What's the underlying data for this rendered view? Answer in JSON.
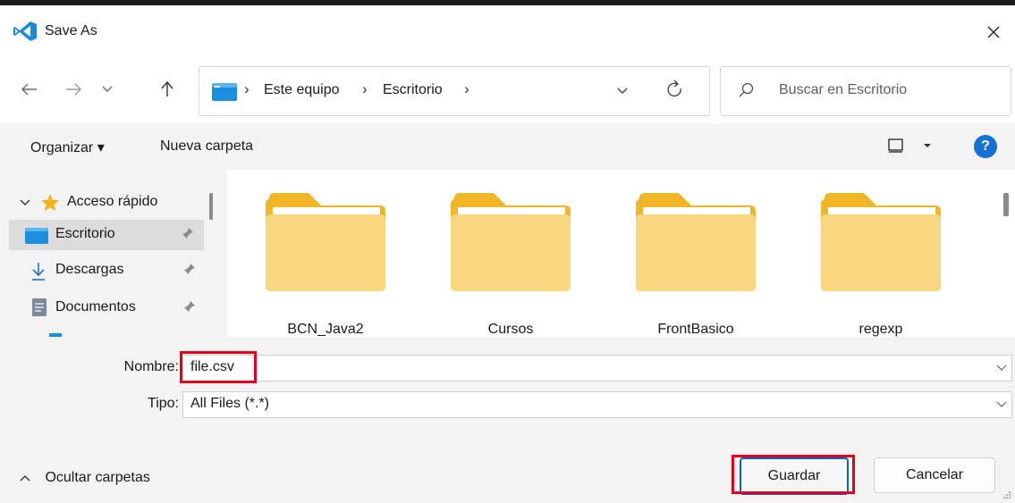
{
  "window": {
    "title": "Save As",
    "app_icon": "vscode-icon",
    "close_glyph": "✕"
  },
  "navigation": {
    "back_glyph": "←",
    "forward_glyph": "→",
    "recent_glyph": "⌄",
    "up_glyph": "↑",
    "breadcrumb": [
      "Este equipo",
      "Escritorio"
    ],
    "separator": "›",
    "search_placeholder": "Buscar en Escritorio"
  },
  "toolbar": {
    "organize_label": "Organizar ▾",
    "new_folder_label": "Nueva carpeta",
    "help_label": "?"
  },
  "nav_pane": {
    "quick_access_label": "Acceso rápido",
    "items": [
      {
        "label": "Escritorio",
        "icon": "desktop-icon",
        "pinned": true,
        "selected": true
      },
      {
        "label": "Descargas",
        "icon": "download-icon",
        "pinned": true,
        "selected": false
      },
      {
        "label": "Documentos",
        "icon": "document-icon",
        "pinned": true,
        "selected": false
      }
    ]
  },
  "folders": [
    {
      "name": "BCN_Java2"
    },
    {
      "name": "Cursos"
    },
    {
      "name": "FrontBasico"
    },
    {
      "name": "regexp"
    }
  ],
  "form": {
    "filename_label": "Nombre:",
    "filename_value": "file.csv",
    "type_label": "Tipo:",
    "type_value": "All Files (*.*)"
  },
  "footer": {
    "hide_folders_label": "Ocultar carpetas",
    "save_label": "Guardar",
    "cancel_label": "Cancelar"
  },
  "colors": {
    "highlight": "#e5001b",
    "accent": "#0b64c8",
    "folder_front": "#f9d77e",
    "folder_back": "#f0b628"
  }
}
